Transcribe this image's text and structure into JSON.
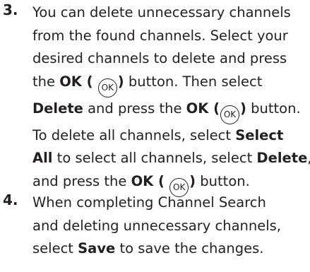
{
  "step3": {
    "number": "3.",
    "l1": "You can delete unnecessary channels",
    "l2": "from the found channels. Select your",
    "l3": "desired channels to delete and press",
    "l4_a": "the ",
    "l4_ok": "OK (",
    "ok_icon_text": "OK",
    "l4_close": ")",
    "l4_b": " button. Then select",
    "l5_delete": "Delete",
    "l5_a": " and press the ",
    "l5_ok": "OK (",
    "l5_close": ")",
    "l5_b": " button.",
    "l6_a": "To delete all channels, select ",
    "l6_select": "Select",
    "l7_all": "All",
    "l7_a": " to select all channels, select ",
    "l7_delete": "Delete",
    "l7_b": ",",
    "l8_a": "and press the ",
    "l8_ok": "OK (",
    "l8_close": ")",
    "l8_b": " button."
  },
  "step4": {
    "number": "4.",
    "l1": "When completing Channel Search",
    "l2": "and deleting unnecessary channels,",
    "l3_a": "select ",
    "l3_save": "Save",
    "l3_b": " to save the changes."
  },
  "icons": {
    "ok_button": "ok-circle-icon"
  }
}
